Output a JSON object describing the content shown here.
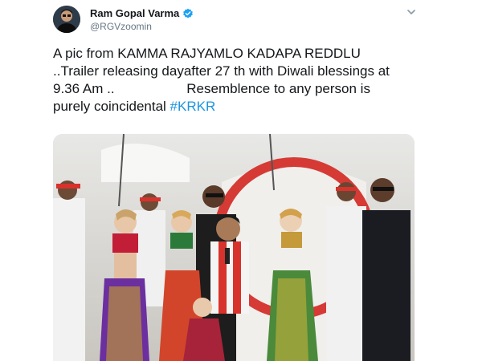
{
  "author": {
    "display_name": "Ram Gopal Varma",
    "handle": "@RGVzoomin",
    "verified": true,
    "avatar_icon": "profile-photo"
  },
  "tweet": {
    "text_main": "A pic from KAMMA RAJYAMLO KADAPA REDDLU\n..Trailer releasing dayafter 27 th with Diwali blessings at\n9.36 Am ..                   Resemblence to any person is\npurely coincidental ",
    "hashtag": "#KRKR"
  },
  "media": {
    "type": "photo",
    "description_icon": "stage-photo"
  },
  "colors": {
    "link": "#1b95e0",
    "verified": "#1da1f2",
    "secondary_text": "#657786"
  }
}
